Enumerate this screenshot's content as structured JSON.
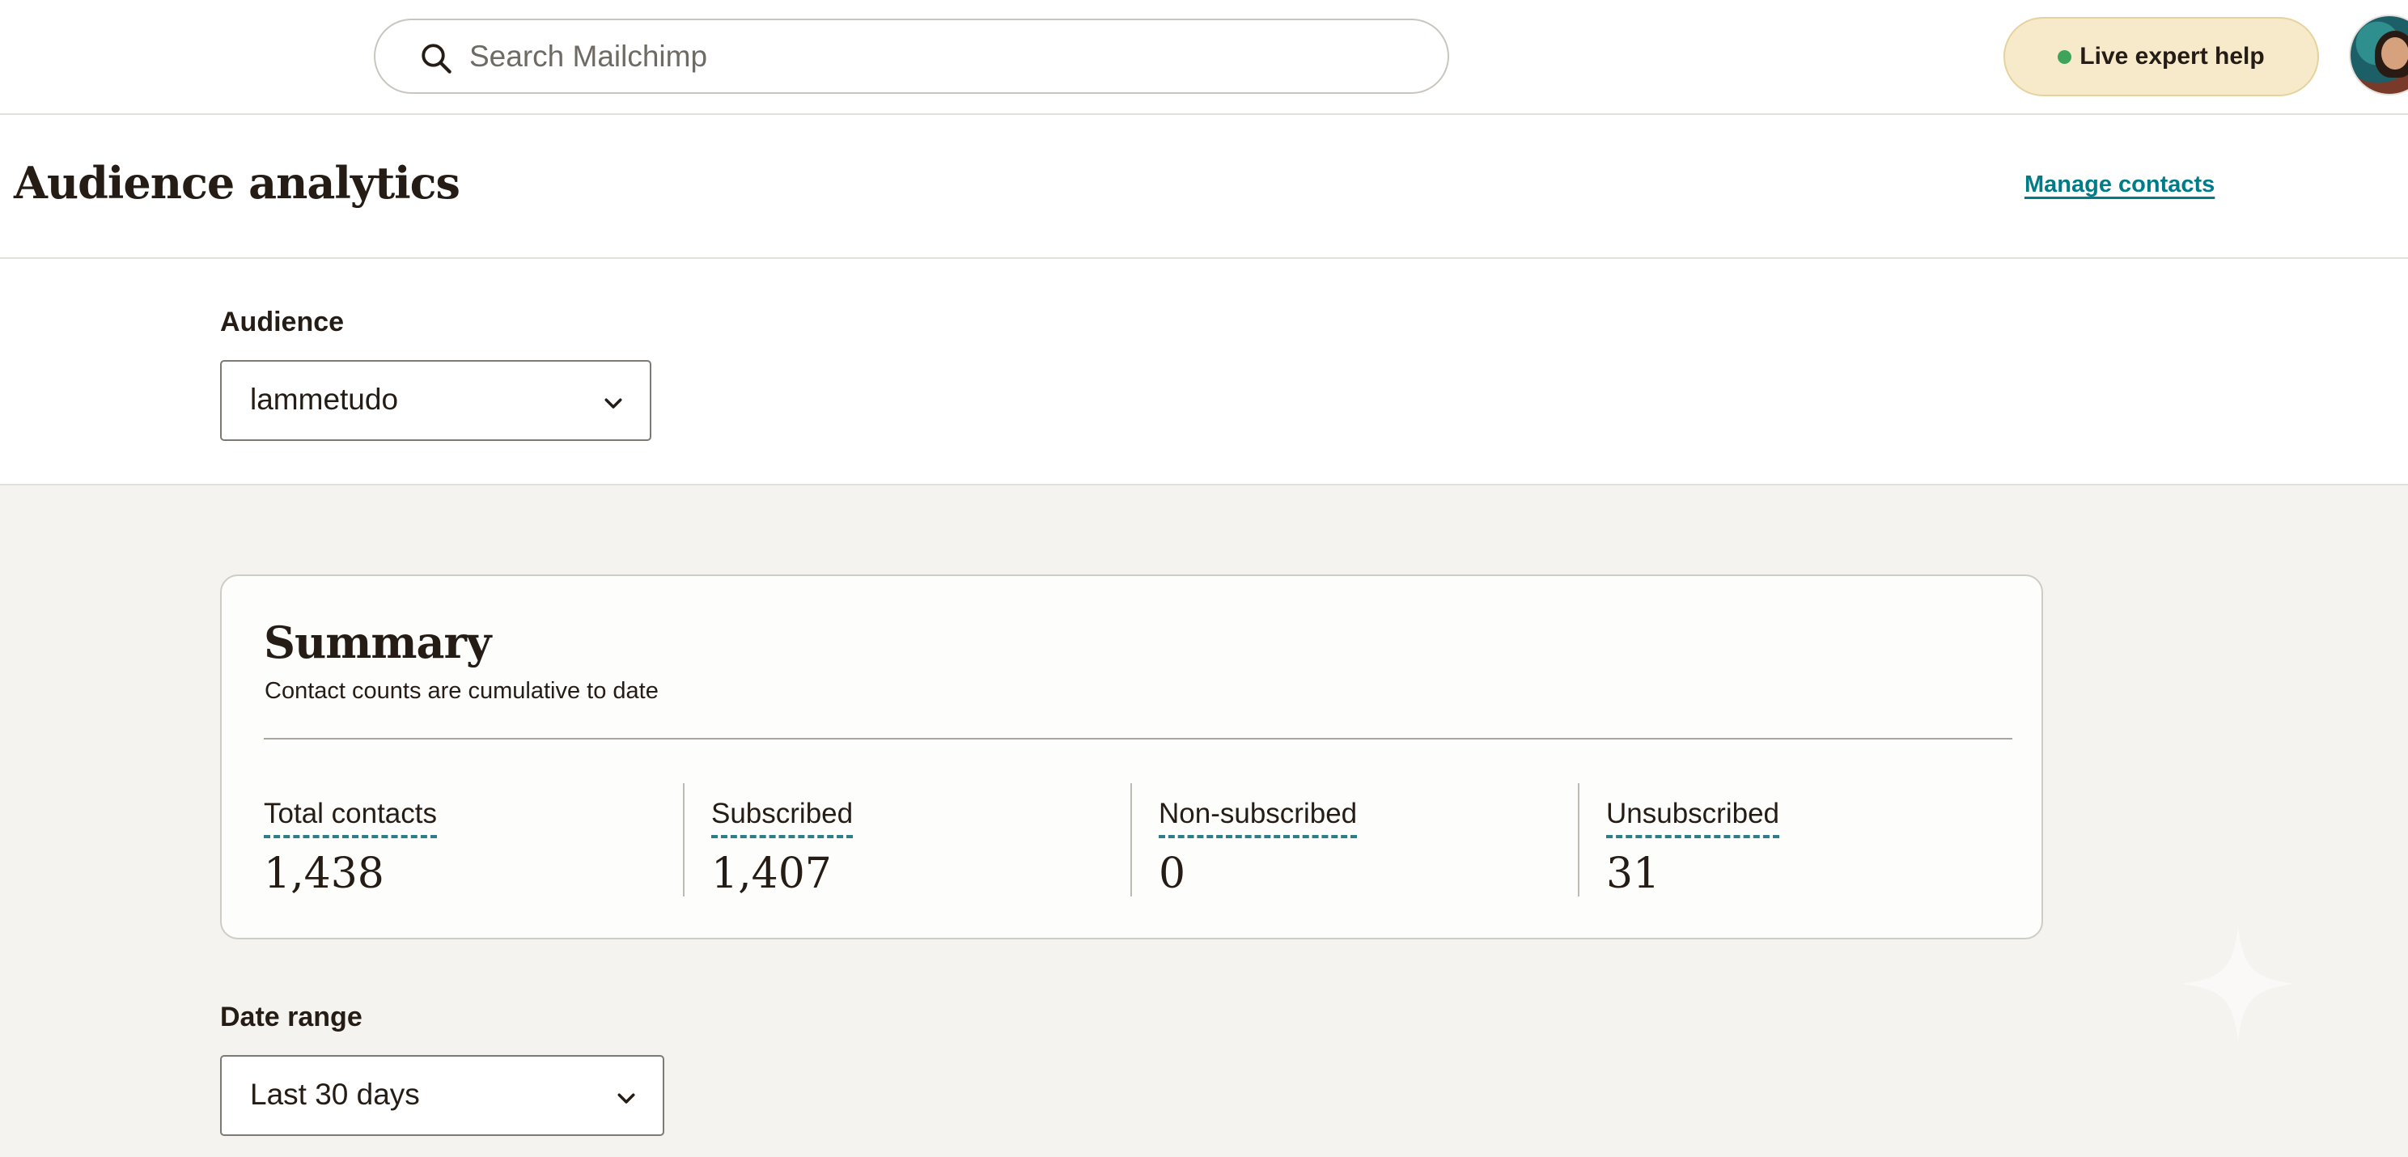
{
  "topbar": {
    "search_placeholder": "Search Mailchimp",
    "help_button_label": "Live expert help",
    "help_status_color": "#3fa45b"
  },
  "header": {
    "title": "Audience analytics",
    "manage_contacts_label": "Manage contacts"
  },
  "audience": {
    "label": "Audience",
    "selected": "lammetudo"
  },
  "summary": {
    "title": "Summary",
    "subtitle": "Contact counts are cumulative to date",
    "stats": [
      {
        "label": "Total contacts",
        "value": "1,438"
      },
      {
        "label": "Subscribed",
        "value": "1,407"
      },
      {
        "label": "Non-subscribed",
        "value": "0"
      },
      {
        "label": "Unsubscribed",
        "value": "31"
      }
    ]
  },
  "date_range": {
    "label": "Date range",
    "selected": "Last 30 days"
  },
  "colors": {
    "accent": "#007c89",
    "help_button_bg": "#f6eacb",
    "content_bg": "#f4f3ef"
  },
  "icons": {
    "search": "search-icon",
    "chevron": "chevron-down-icon",
    "sparkle": "sparkle-icon"
  }
}
